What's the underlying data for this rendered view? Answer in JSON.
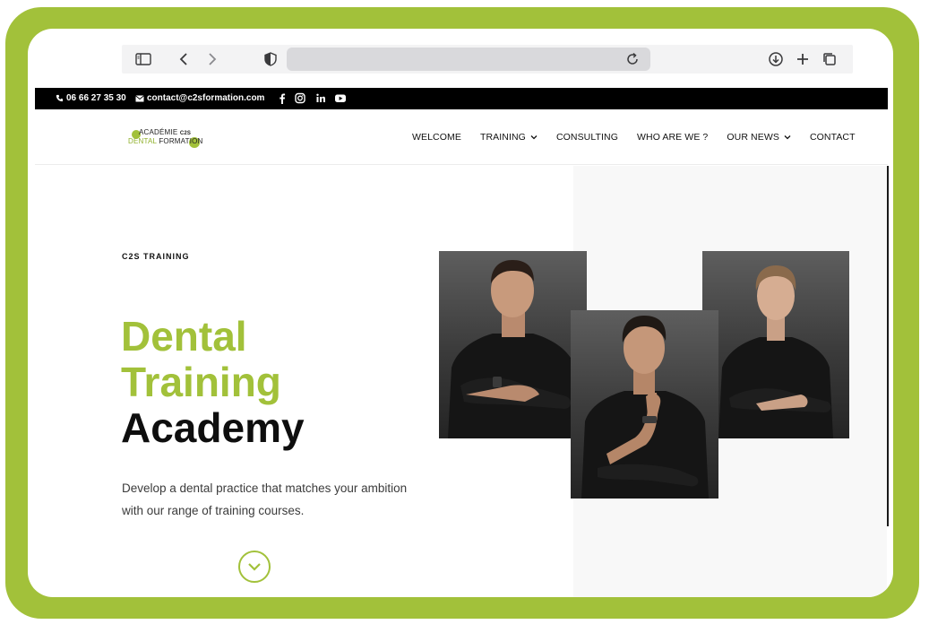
{
  "topbar": {
    "phone": "06 66 27 35 30",
    "email": "contact@c2sformation.com",
    "social_icons": [
      "facebook-icon",
      "instagram-icon",
      "linkedin-icon",
      "youtube-icon"
    ]
  },
  "logo": {
    "line1": "ACADÉMIE",
    "line1_mark": "C2S",
    "line2_green": "DENTAL",
    "line2": "FORMATION"
  },
  "nav": {
    "items": [
      {
        "label": "WELCOME",
        "dropdown": false
      },
      {
        "label": "TRAINING",
        "dropdown": true
      },
      {
        "label": "CONSULTING",
        "dropdown": false
      },
      {
        "label": "WHO ARE WE ?",
        "dropdown": false
      },
      {
        "label": "OUR NEWS",
        "dropdown": true
      },
      {
        "label": "CONTACT",
        "dropdown": false
      }
    ]
  },
  "hero": {
    "eyebrow": "C2S TRAINING",
    "headline_green_1": "Dental",
    "headline_green_2": "Training",
    "headline_dark": "Academy",
    "description": "Develop a dental practice that matches your ambition with our range of training courses."
  },
  "colors": {
    "accent": "#a2c13a",
    "topbar_bg": "#000000",
    "text_dark": "#0e0e0e"
  }
}
